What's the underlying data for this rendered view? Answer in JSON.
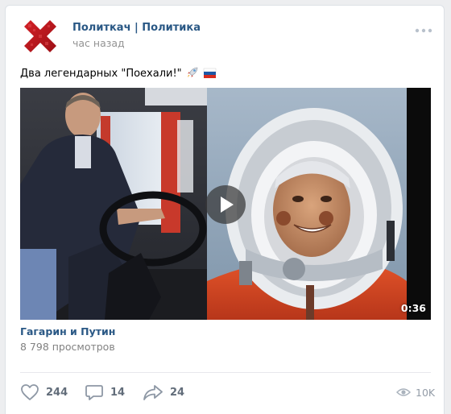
{
  "post": {
    "group_name": "Политкач | Политика",
    "time": "час назад",
    "text": "Два легендарных \"Поехали!\""
  },
  "video": {
    "title": "Гагарин и Путин",
    "views": "8 798 просмотров",
    "duration": "0:36"
  },
  "actions": {
    "likes": "244",
    "comments": "14",
    "shares": "24",
    "views": "10K"
  },
  "icons": {
    "avatar": "red-x-logo",
    "more": "more-dots-icon",
    "play": "play-icon",
    "like": "heart-icon",
    "comment": "comment-icon",
    "share": "share-arrow-icon",
    "views": "eye-icon",
    "emoji_1": "rocket-icon",
    "emoji_2": "russia-flag-icon"
  },
  "colors": {
    "link": "#2a5885",
    "meta": "#939393",
    "action": "#626d7a",
    "avatar_red": "#c0171d"
  }
}
